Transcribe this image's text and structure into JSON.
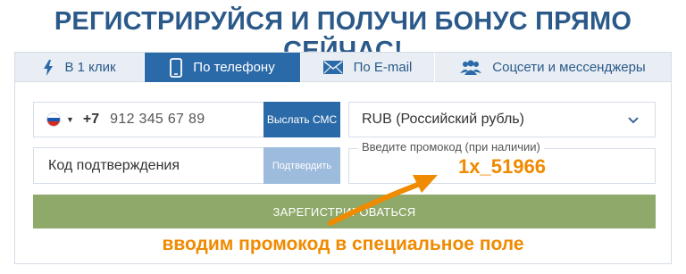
{
  "headline": "РЕГИСТРИРУЙСЯ И ПОЛУЧИ БОНУС ПРЯМО СЕЙЧАС!",
  "tabs": [
    {
      "label": "В 1 клик",
      "icon": "lightning-icon",
      "active": false
    },
    {
      "label": "По телефону",
      "icon": "phone-icon",
      "active": true
    },
    {
      "label": "По E-mail",
      "icon": "mail-icon",
      "active": false
    },
    {
      "label": "Соцсети и мессенджеры",
      "icon": "people-icon",
      "active": false
    }
  ],
  "phone": {
    "country_flag": "russia-flag-icon",
    "prefix": "+7",
    "value": "912 345 67 89",
    "send_sms_label": "Выслать СМС"
  },
  "confirmation": {
    "placeholder": "Код подтверждения",
    "confirm_label": "Подтвердить"
  },
  "currency": {
    "value": "RUB (Российский рубль)"
  },
  "promo": {
    "label": "Введите промокод (при наличии)",
    "value": "1x_51966"
  },
  "register_label": "ЗАРЕГИСТРИРОВАТЬСЯ",
  "annotation": "вводим промокод в специальное поле",
  "colors": {
    "brand_blue": "#2b6aa8",
    "headline_blue": "#2b5a8a",
    "accent_orange": "#f08a00",
    "register_green": "#8fa96a",
    "disabled_blue": "#9dbbdc"
  }
}
